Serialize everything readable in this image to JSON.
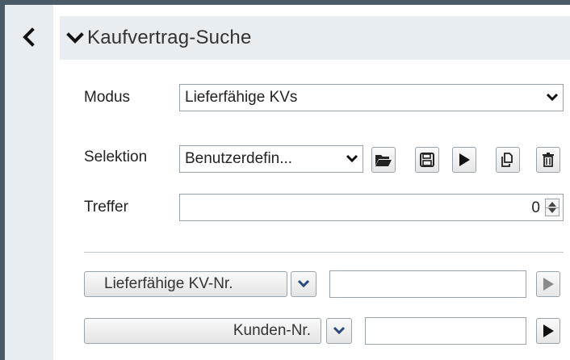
{
  "panel": {
    "title": "Kaufvertrag-Suche"
  },
  "form": {
    "modus": {
      "label": "Modus",
      "value": "Lieferfähige KVs"
    },
    "selektion": {
      "label": "Selektion",
      "value": "Benutzerdefin..."
    },
    "treffer": {
      "label": "Treffer",
      "value": "0"
    }
  },
  "selection_tools": [
    {
      "icon": "folder-open-icon"
    },
    {
      "icon": "save-icon"
    },
    {
      "icon": "play-icon"
    },
    {
      "icon": "copy-icon"
    },
    {
      "icon": "trash-icon"
    }
  ],
  "filters": [
    {
      "label": "Lieferfähige KV-Nr.",
      "value": ""
    },
    {
      "label": "Kunden-Nr.",
      "value": ""
    }
  ],
  "colors": {
    "border_dark": "#4a5a66",
    "header_bg": "#e8edf1",
    "play_active": "#111111",
    "play_disabled": "#8a8a8a"
  }
}
